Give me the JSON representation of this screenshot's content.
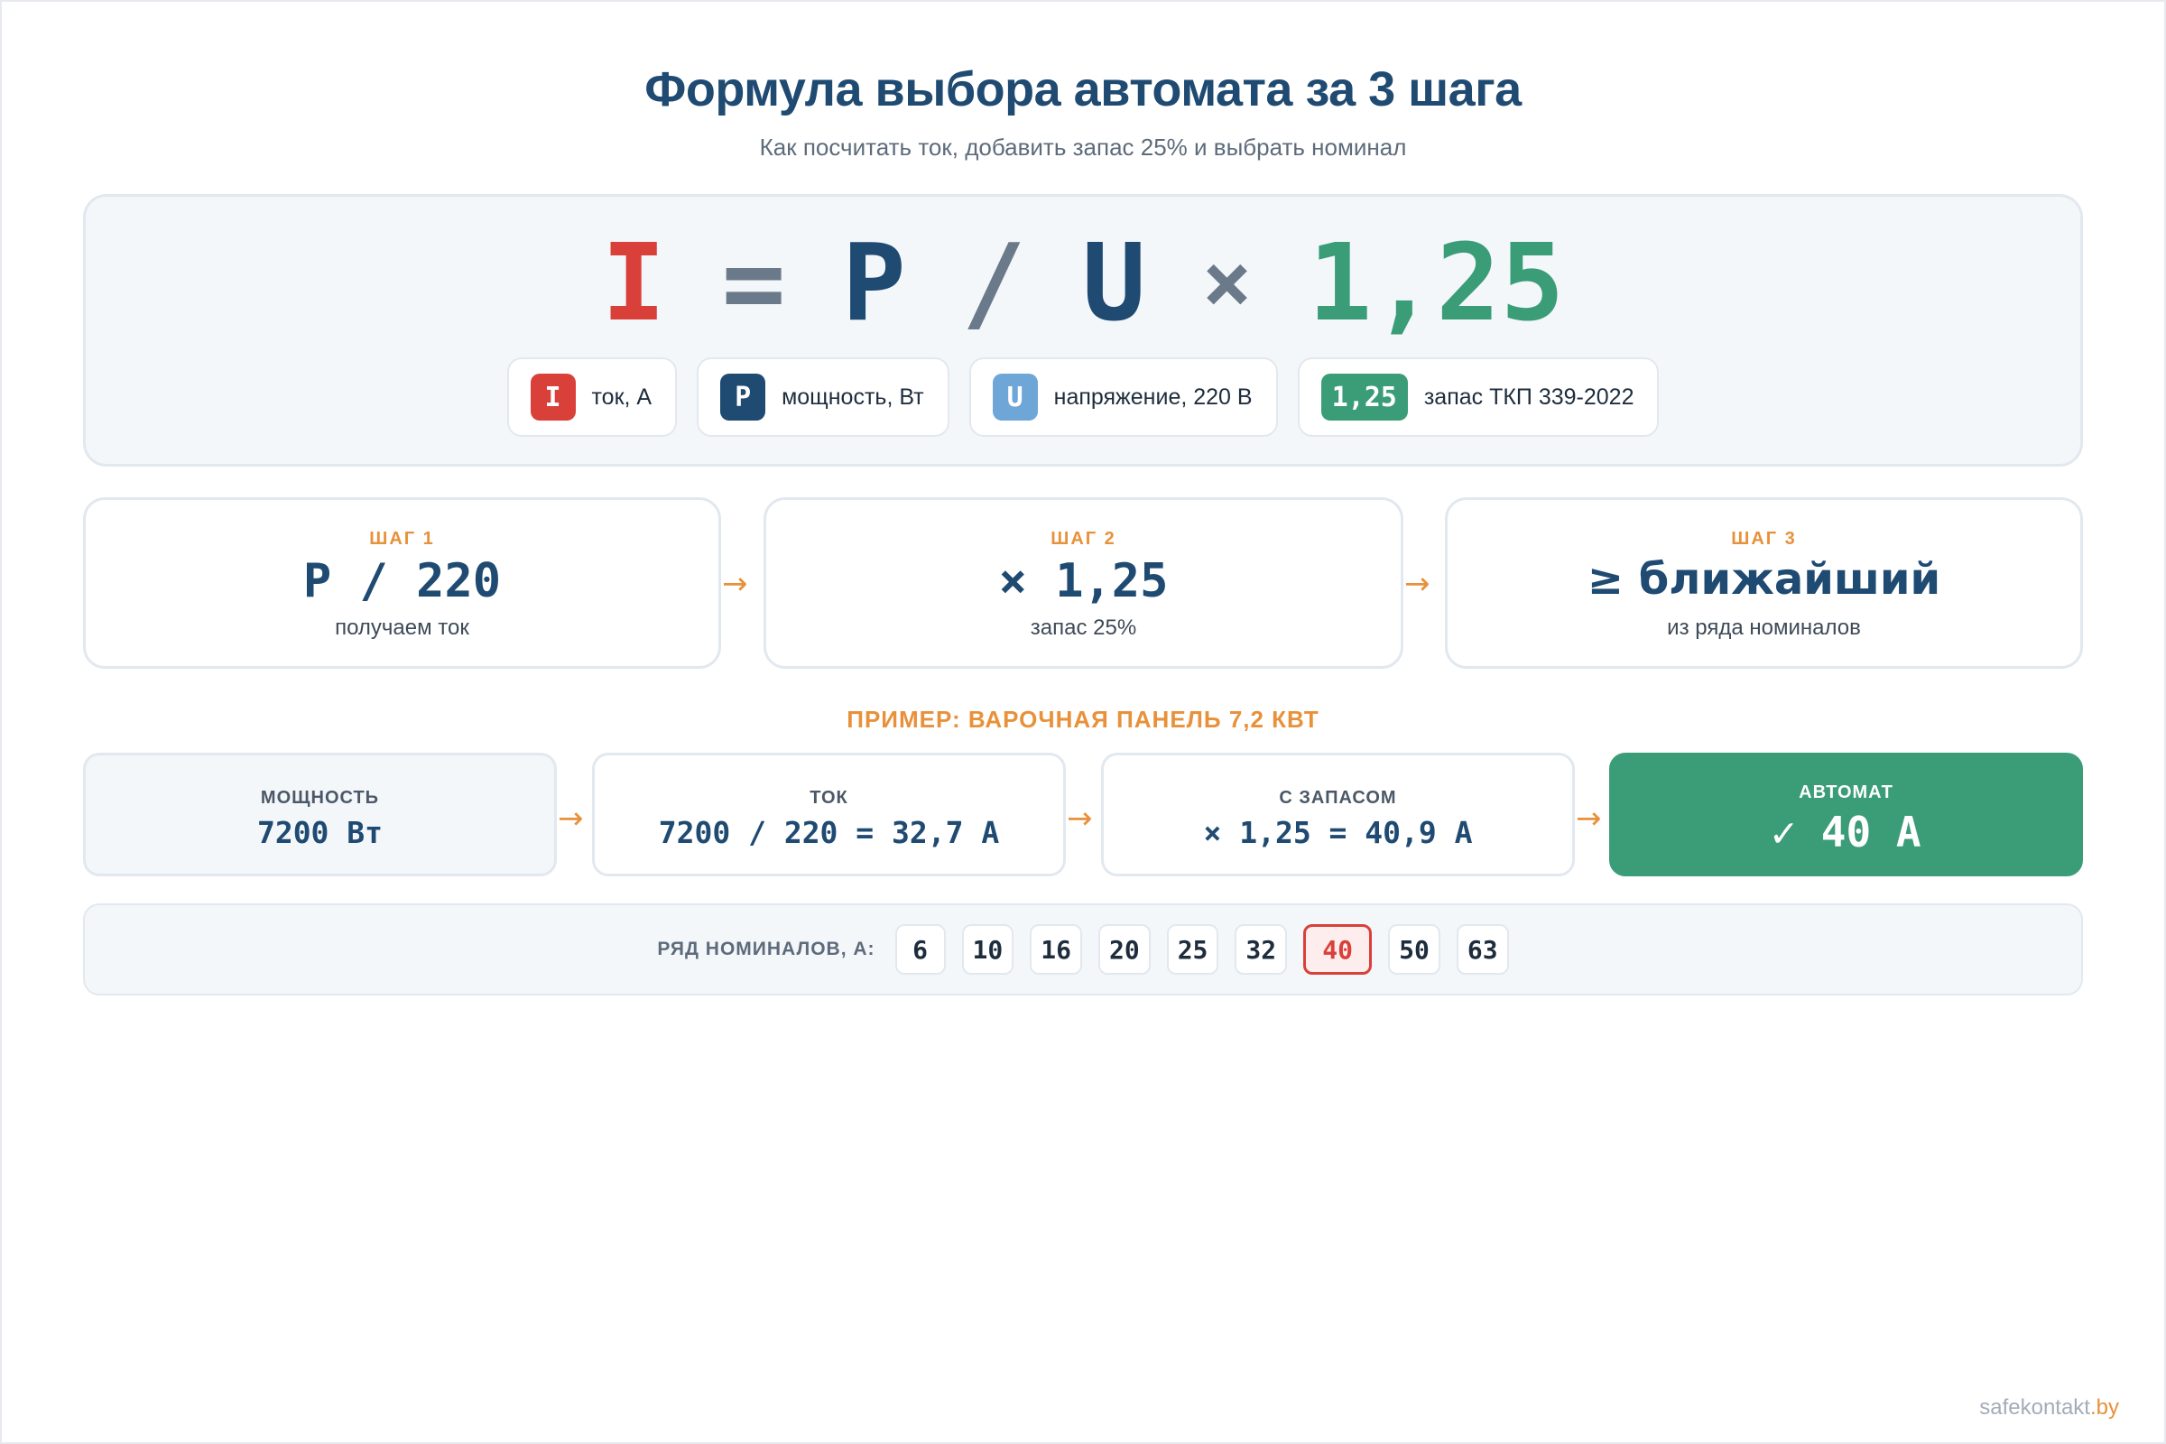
{
  "header": {
    "title": "Формула выбора автомата за 3 шага",
    "subtitle": "Как посчитать ток, добавить запас 25% и выбрать номинал"
  },
  "formula": {
    "current": "I",
    "equals": "=",
    "power": "P",
    "divide": "/",
    "voltage": "U",
    "multiply": "×",
    "coefficient": "1,25"
  },
  "legend": [
    {
      "badge": "I",
      "text": "ток, А",
      "color": "#d9403a"
    },
    {
      "badge": "P",
      "text": "мощность, Вт",
      "color": "#1f4a72"
    },
    {
      "badge": "U",
      "text": "напряжение, 220 В",
      "color": "#6fa6d8"
    },
    {
      "badge": "1,25",
      "text": "запас ТКП 339-2022",
      "color": "#3a9d78"
    }
  ],
  "steps": [
    {
      "kicker": "ШАГ 1",
      "main": "P / 220",
      "sub": "получаем ток"
    },
    {
      "kicker": "ШАГ 2",
      "main": "× 1,25",
      "sub": "запас 25%"
    },
    {
      "kicker": "ШАГ 3",
      "main": "≥ ближайший",
      "sub": "из ряда номиналов"
    }
  ],
  "arrow_glyph": "→",
  "example": {
    "title": "ПРИМЕР: ВАРОЧНАЯ ПАНЕЛЬ 7,2 КВТ",
    "boxes": [
      {
        "label": "МОЩНОСТЬ",
        "value": "7200 Вт"
      },
      {
        "label": "ТОК",
        "value": "7200 / 220 = 32,7 А"
      },
      {
        "label": "С ЗАПАСОМ",
        "value": "× 1,25 = 40,9 А"
      },
      {
        "label": "АВТОМАТ",
        "value": "✓ 40 А"
      }
    ]
  },
  "ratings": {
    "label": "РЯД НОМИНАЛОВ, А:",
    "values": [
      "6",
      "10",
      "16",
      "20",
      "25",
      "32",
      "40",
      "50",
      "63"
    ],
    "selected": "40"
  },
  "footer": {
    "brand": "safekontakt",
    "domain": ".by"
  },
  "colors": {
    "accent_orange": "#e8913a",
    "navy": "#1f4a72",
    "red": "#d9403a",
    "green": "#3a9d78",
    "light_blue": "#6fa6d8"
  }
}
